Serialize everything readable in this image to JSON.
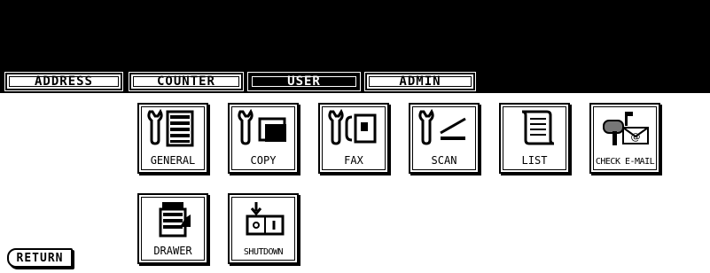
{
  "tabs": [
    {
      "label": "ADDRESS",
      "active": false
    },
    {
      "label": "COUNTER",
      "active": false
    },
    {
      "label": "USER",
      "active": true
    },
    {
      "label": "ADMIN",
      "active": false
    }
  ],
  "buttons": {
    "general": {
      "label": "GENERAL",
      "icon": "wrench-copier-icon"
    },
    "copy": {
      "label": "COPY",
      "icon": "wrench-copy-icon"
    },
    "fax": {
      "label": "FAX",
      "icon": "wrench-fax-icon"
    },
    "scan": {
      "label": "SCAN",
      "icon": "wrench-scan-icon"
    },
    "list": {
      "label": "LIST",
      "icon": "scroll-list-icon"
    },
    "check_email": {
      "label": "CHECK E-MAIL",
      "icon": "mailbox-email-icon"
    },
    "drawer": {
      "label": "DRAWER",
      "icon": "drawer-copier-icon"
    },
    "shutdown": {
      "label": "SHUTDOWN",
      "icon": "power-switch-icon"
    }
  },
  "return_label": "RETURN"
}
